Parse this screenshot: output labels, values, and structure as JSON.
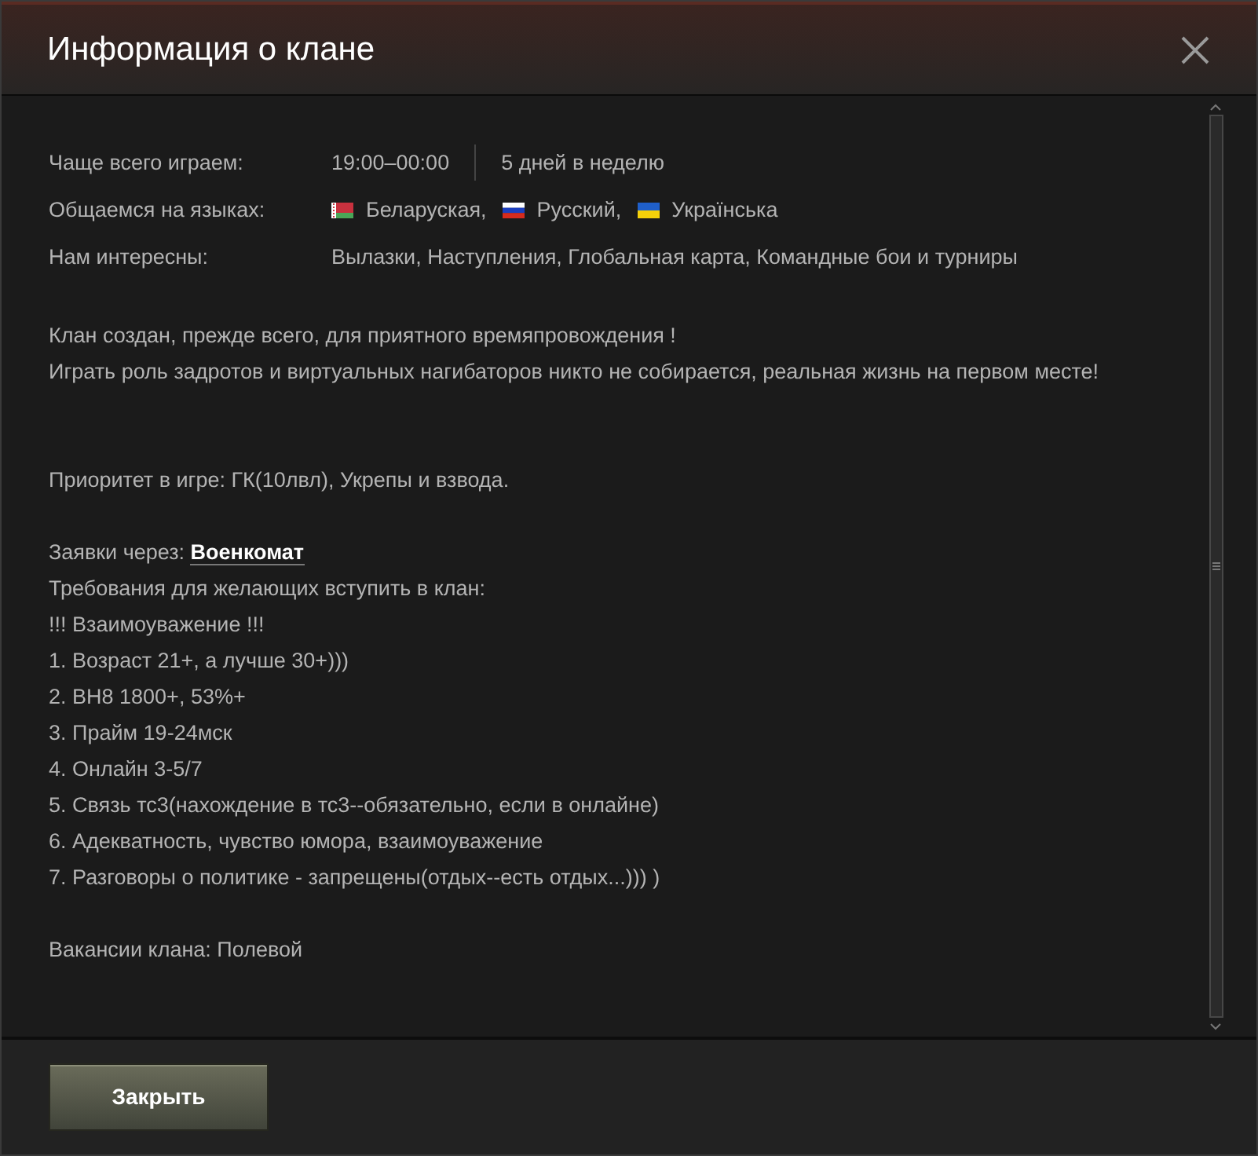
{
  "window": {
    "title": "Информация о клане"
  },
  "info": [
    {
      "kind": "schedule",
      "label": "Чаще всего играем:",
      "values": [
        "19:00–00:00",
        "5 дней в неделю"
      ]
    },
    {
      "kind": "languages",
      "label": "Общаемся на языках:",
      "languages": [
        {
          "kind": "by",
          "name": "Беларуская,"
        },
        {
          "kind": "ru",
          "name": "Русский,"
        },
        {
          "kind": "ua",
          "name": "Українська"
        }
      ]
    },
    {
      "kind": "text",
      "label": "Нам интересны:",
      "values": [
        "Вылазки, Наступления, Глобальная карта, Командные бои и турниры"
      ]
    }
  ],
  "description": [
    {
      "lines": [
        {
          "kind": "text",
          "text": "Клан создан, прежде всего, для приятного времяпровождения !"
        },
        {
          "kind": "text",
          "text": "Играть роль задротов и виртуальных нагибаторов никто не собирается, реальная жизнь на первом месте!"
        }
      ]
    },
    {
      "lines": [
        {
          "kind": "text",
          "text": "Приоритет в игре: ГК(10лвл), Укрепы и взвода."
        }
      ]
    },
    {
      "lines": [
        {
          "kind": "link",
          "text": "Заявки через: ",
          "link": "Военкомат"
        },
        {
          "kind": "text",
          "text": "Требования для желающих вступить в клан:"
        },
        {
          "kind": "text",
          "text": "!!! Взаимоуважение !!!"
        },
        {
          "kind": "text",
          "text": "1. Возраст 21+, а лучше 30+)))"
        },
        {
          "kind": "text",
          "text": "2. ВН8 1800+, 53%+"
        },
        {
          "kind": "text",
          "text": "3. Прайм 19-24мск"
        },
        {
          "kind": "text",
          "text": "4. Онлайн 3-5/7"
        },
        {
          "kind": "text",
          "text": "5. Связь тс3(нахождение в тс3--обязательно, если в онлайне)"
        },
        {
          "kind": "text",
          "text": "6. Адекватность, чувство юмора, взаимоуважение"
        },
        {
          "kind": "text",
          "text": "7. Разговоры о политике - запрещены(отдых--есть отдых...))) )"
        }
      ]
    },
    {
      "lines": [
        {
          "kind": "text",
          "text": "Вакансии клана: Полевой"
        }
      ]
    }
  ],
  "buttons": [
    {
      "label": "Закрыть"
    }
  ]
}
